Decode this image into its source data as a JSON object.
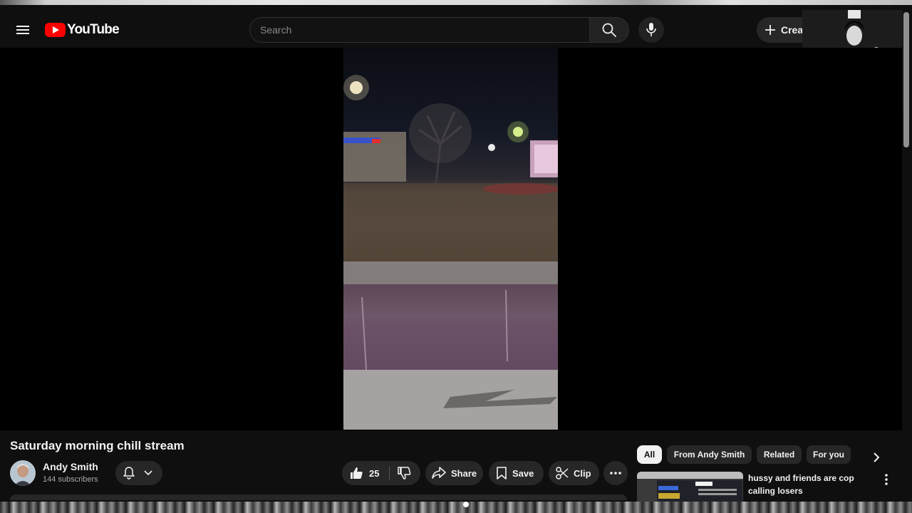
{
  "header": {
    "logo_text": "YouTube",
    "search_placeholder": "Search",
    "create_label": "Creat"
  },
  "video": {
    "title": "Saturday morning chill stream",
    "channel": {
      "name": "Andy Smith",
      "subscribers": "144 subscribers"
    },
    "actions": {
      "like_count": "25",
      "share_label": "Share",
      "save_label": "Save",
      "clip_label": "Clip"
    }
  },
  "chips": [
    {
      "label": "All",
      "active": true
    },
    {
      "label": "From Andy Smith",
      "active": false
    },
    {
      "label": "Related",
      "active": false
    },
    {
      "label": "For you",
      "active": false
    }
  ],
  "recommended": [
    {
      "title": "hussy and friends are cop calling losers"
    }
  ],
  "icons": {
    "menu": "menu-icon",
    "search": "search-icon",
    "mic": "mic-icon",
    "create": "plus-icon",
    "bell": "bell-icon",
    "like": "thumbs-up-icon",
    "dislike": "thumbs-down-icon",
    "share": "share-icon",
    "save": "bookmark-icon",
    "clip": "scissors-icon",
    "more": "more-horizontal-icon"
  },
  "colors": {
    "background": "#0f0f0f",
    "brand_red": "#ff0000",
    "button_bg": "#272727",
    "secondary_text": "#aaaaaa"
  }
}
